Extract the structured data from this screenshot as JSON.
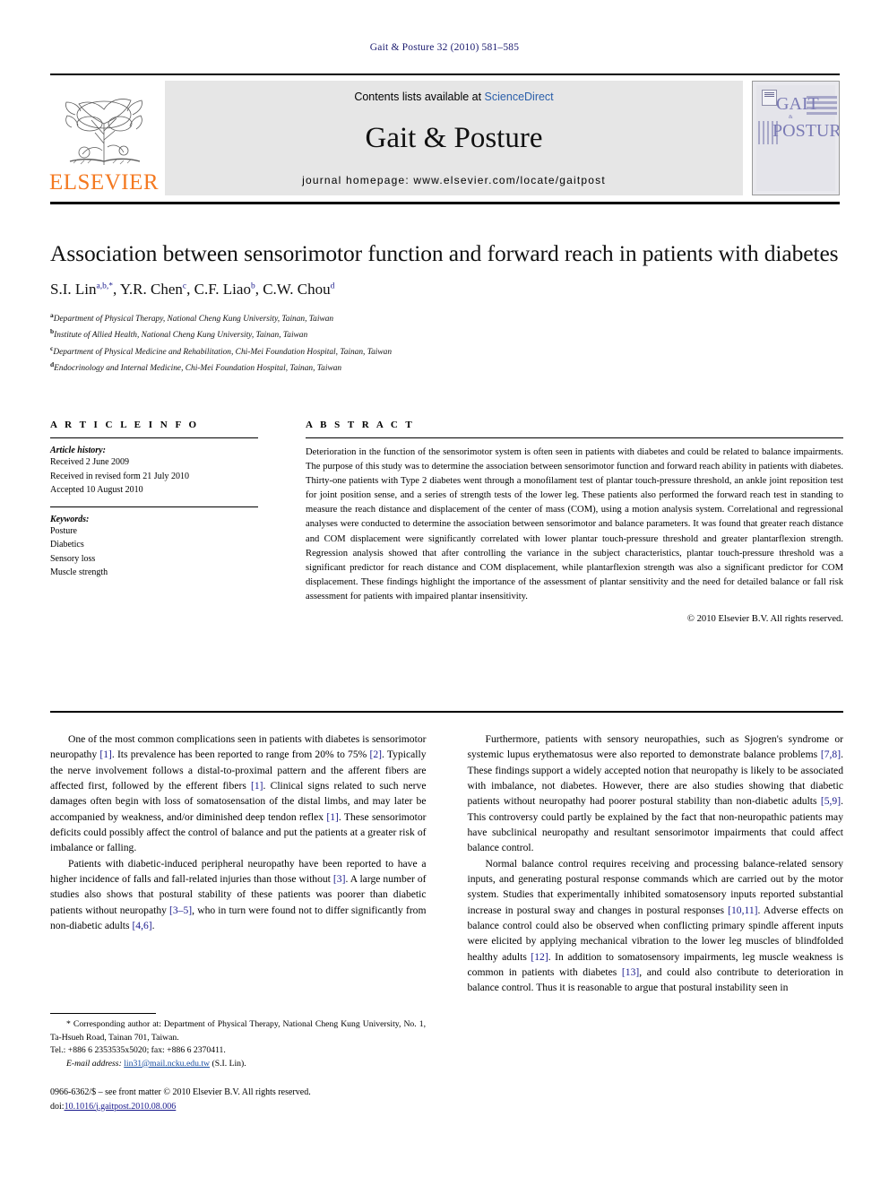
{
  "running_head": "Gait & Posture 32 (2010) 581–585",
  "masthead": {
    "contents_prefix": "Contents lists available at ",
    "sciencedirect": "ScienceDirect",
    "journal_name": "Gait & Posture",
    "homepage": "journal homepage: www.elsevier.com/locate/gaitpost",
    "publisher_logo_text": "ELSEVIER",
    "cover": {
      "line1": "GAIT",
      "amp": "&",
      "line2": "POSTURE"
    },
    "accent_link_color": "#2b5faa",
    "elsevier_orange": "#F47920",
    "cover_blue": "#7b7bb5"
  },
  "article": {
    "title": "Association between sensorimotor function and forward reach in patients with diabetes",
    "authors": [
      {
        "name": "S.I. Lin",
        "sup": "a,b,*"
      },
      {
        "name": "Y.R. Chen",
        "sup": "c"
      },
      {
        "name": "C.F. Liao",
        "sup": "b"
      },
      {
        "name": "C.W. Chou",
        "sup": "d"
      }
    ],
    "affiliations": [
      {
        "marker": "a",
        "text": "Department of Physical Therapy, National Cheng Kung University, Tainan, Taiwan"
      },
      {
        "marker": "b",
        "text": "Institute of Allied Health, National Cheng Kung University, Tainan, Taiwan"
      },
      {
        "marker": "c",
        "text": "Department of Physical Medicine and Rehabilitation, Chi-Mei Foundation Hospital, Tainan, Taiwan"
      },
      {
        "marker": "d",
        "text": "Endocrinology and Internal Medicine, Chi-Mei Foundation Hospital, Tainan, Taiwan"
      }
    ]
  },
  "article_info": {
    "heading": "A R T I C L E   I N F O",
    "history_label": "Article history:",
    "history": [
      "Received 2 June 2009",
      "Received in revised form 21 July 2010",
      "Accepted 10 August 2010"
    ],
    "keywords_label": "Keywords:",
    "keywords": [
      "Posture",
      "Diabetics",
      "Sensory loss",
      "Muscle strength"
    ]
  },
  "abstract": {
    "heading": "A B S T R A C T",
    "text": "Deterioration in the function of the sensorimotor system is often seen in patients with diabetes and could be related to balance impairments. The purpose of this study was to determine the association between sensorimotor function and forward reach ability in patients with diabetes. Thirty-one patients with Type 2 diabetes went through a monofilament test of plantar touch-pressure threshold, an ankle joint reposition test for joint position sense, and a series of strength tests of the lower leg. These patients also performed the forward reach test in standing to measure the reach distance and displacement of the center of mass (COM), using a motion analysis system. Correlational and regressional analyses were conducted to determine the association between sensorimotor and balance parameters. It was found that greater reach distance and COM displacement were significantly correlated with lower plantar touch-pressure threshold and greater plantarflexion strength. Regression analysis showed that after controlling the variance in the subject characteristics, plantar touch-pressure threshold was a significant predictor for reach distance and COM displacement, while plantarflexion strength was also a significant predictor for COM displacement. These findings highlight the importance of the assessment of plantar sensitivity and the need for detailed balance or fall risk assessment for patients with impaired plantar insensitivity.",
    "copyright": "© 2010 Elsevier B.V. All rights reserved."
  },
  "body": {
    "left_column": [
      "One of the most common complications seen in patients with diabetes is sensorimotor neuropathy [1]. Its prevalence has been reported to range from 20% to 75% [2]. Typically the nerve involvement follows a distal-to-proximal pattern and the afferent fibers are affected first, followed by the efferent fibers [1]. Clinical signs related to such nerve damages often begin with loss of somatosensation of the distal limbs, and may later be accompanied by weakness, and/or diminished deep tendon reflex [1]. These sensorimotor deficits could possibly affect the control of balance and put the patients at a greater risk of imbalance or falling.",
      "Patients with diabetic-induced peripheral neuropathy have been reported to have a higher incidence of falls and fall-related injuries than those without [3]. A large number of studies also shows that postural stability of these patients was poorer than diabetic patients without neuropathy [3–5], who in turn were found not to differ significantly from non-diabetic adults [4,6]."
    ],
    "right_column": [
      "Furthermore, patients with sensory neuropathies, such as Sjogren's syndrome or systemic lupus erythematosus were also reported to demonstrate balance problems [7,8]. These findings support a widely accepted notion that neuropathy is likely to be associated with imbalance, not diabetes. However, there are also studies showing that diabetic patients without neuropathy had poorer postural stability than non-diabetic adults [5,9]. This controversy could partly be explained by the fact that non-neuropathic patients may have subclinical neuropathy and resultant sensorimotor impairments that could affect balance control.",
      "Normal balance control requires receiving and processing balance-related sensory inputs, and generating postural response commands which are carried out by the motor system. Studies that experimentally inhibited somatosensory inputs reported substantial increase in postural sway and changes in postural responses [10,11]. Adverse effects on balance control could also be observed when conflicting primary spindle afferent inputs were elicited by applying mechanical vibration to the lower leg muscles of blindfolded healthy adults [12]. In addition to somatosensory impairments, leg muscle weakness is common in patients with diabetes [13], and could also contribute to deterioration in balance control. Thus it is reasonable to argue that postural instability seen in"
    ]
  },
  "footnote": {
    "corresponding": "* Corresponding author at: Department of Physical Therapy, National Cheng Kung University, No. 1, Ta-Hsueh Road, Tainan 701, Taiwan.",
    "tel": "Tel.: +886 6 2353535x5020; fax: +886 6 2370411.",
    "email_label": "E-mail address:",
    "email": "lin31@mail.ncku.edu.tw",
    "email_owner": "(S.I. Lin)."
  },
  "imprint": {
    "line1": "0966-6362/$ – see front matter © 2010 Elsevier B.V. All rights reserved.",
    "doi_label": "doi:",
    "doi": "10.1016/j.gaitpost.2010.08.006"
  }
}
